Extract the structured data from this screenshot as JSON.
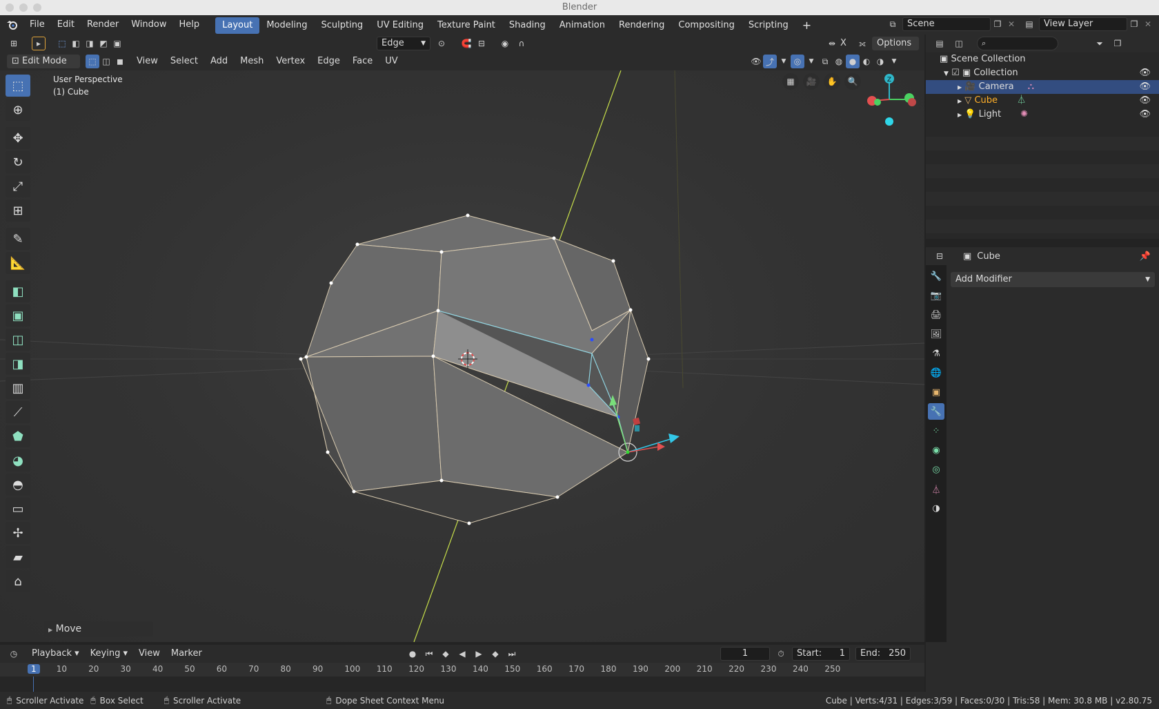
{
  "window": {
    "title": "Blender"
  },
  "menubar": {
    "items": [
      "File",
      "Edit",
      "Render",
      "Window",
      "Help"
    ],
    "workspaces": [
      "Layout",
      "Modeling",
      "Sculpting",
      "UV Editing",
      "Texture Paint",
      "Shading",
      "Animation",
      "Rendering",
      "Compositing",
      "Scripting"
    ],
    "active_workspace": "Layout",
    "add_workspace": "+",
    "scene_label": "Scene",
    "view_layer_label": "View Layer"
  },
  "viewport_header": {
    "select_mode_dropdown": "Edge",
    "options_label": "Options",
    "x_label": "X",
    "mode": "Edit Mode",
    "menus": [
      "View",
      "Select",
      "Add",
      "Mesh",
      "Vertex",
      "Edge",
      "Face",
      "UV"
    ]
  },
  "viewport": {
    "perspective_label": "User Perspective",
    "object_label": "(1) Cube",
    "gizmo_z": "Z",
    "last_op_panel": "Move"
  },
  "toolbar": {
    "tools": [
      "select-box",
      "cursor",
      "move",
      "rotate",
      "scale",
      "transform",
      "annotate",
      "measure",
      "add-cube",
      "extrude",
      "inset",
      "bevel",
      "loop-cut",
      "knife",
      "poly-build",
      "spin",
      "smooth",
      "edge-slide",
      "shrink-fatten",
      "shear",
      "rip-region"
    ]
  },
  "outliner": {
    "root": "Scene Collection",
    "collection": "Collection",
    "items": [
      {
        "name": "Camera",
        "selected": true,
        "color": "#e0e0e0"
      },
      {
        "name": "Cube",
        "selected": false,
        "color": "#ffaf29"
      },
      {
        "name": "Light",
        "selected": false,
        "color": "#e0e0e0"
      }
    ]
  },
  "properties": {
    "object_name": "Cube",
    "add_modifier": "Add Modifier"
  },
  "timeline": {
    "menus": [
      "Playback",
      "Keying",
      "View",
      "Marker"
    ],
    "current_frame": "1",
    "start_label": "Start:",
    "start_value": "1",
    "end_label": "End:",
    "end_value": "250",
    "ruler": [
      "1",
      "10",
      "20",
      "30",
      "40",
      "50",
      "60",
      "70",
      "80",
      "90",
      "100",
      "110",
      "120",
      "130",
      "140",
      "150",
      "160",
      "170",
      "180",
      "190",
      "200",
      "210",
      "220",
      "230",
      "240",
      "250"
    ]
  },
  "statusbar": {
    "hint1": "Scroller Activate",
    "hint2": "Box Select",
    "hint3": "Scroller Activate",
    "hint4": "Dope Sheet Context Menu",
    "stats": "Cube | Verts:4/31 | Edges:3/59 | Faces:0/30 | Tris:58 | Mem: 30.8 MB | v2.80.75"
  },
  "colors": {
    "accent": "#4772b3",
    "selected_row": "#334d80",
    "cube_text": "#ffaf29",
    "y_axis_line": "#c8e04a"
  }
}
